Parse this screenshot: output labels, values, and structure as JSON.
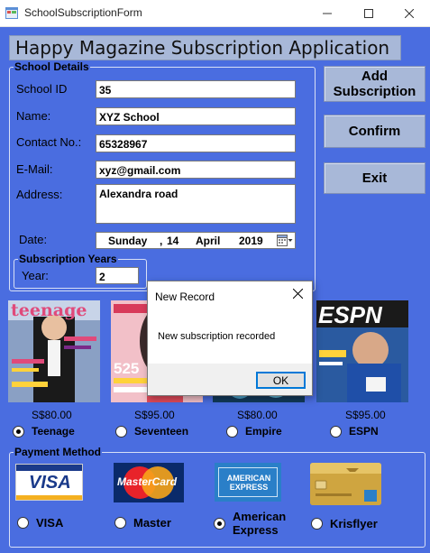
{
  "window": {
    "title": "SchoolSubscriptionForm"
  },
  "header": {
    "title": "Happy Magazine Subscription Application"
  },
  "school_details": {
    "legend": "School Details",
    "fields": {
      "school_id": {
        "label": "School ID",
        "value": "35"
      },
      "name": {
        "label": "Name:",
        "value": "XYZ School"
      },
      "contact": {
        "label": "Contact No.:",
        "value": "65328967"
      },
      "email": {
        "label": "E-Mail:",
        "value": "xyz@gmail.com"
      },
      "address": {
        "label": "Address:",
        "value": "Alexandra road"
      }
    },
    "date": {
      "label": "Date:",
      "weekday": "Sunday",
      "separator": ",",
      "day": "14",
      "month": "April",
      "year": "2019"
    },
    "subscription_years": {
      "legend": "Subscription Years",
      "label": "Year:",
      "value": "2"
    }
  },
  "buttons": {
    "add": "Add Subscription",
    "confirm": "Confirm",
    "exit": "Exit"
  },
  "magazines": [
    {
      "name": "Teenage",
      "price": "S$80.00",
      "selected": true,
      "cover_text": "teenage",
      "cover_color": "#7a8fb8"
    },
    {
      "name": "Seventeen",
      "price": "S$95.00",
      "selected": false,
      "cover_text": "525",
      "cover_color": "#d84a5a"
    },
    {
      "name": "Empire",
      "price": "S$80.00",
      "selected": false,
      "cover_text": "",
      "cover_color": "#2a7fb0"
    },
    {
      "name": "ESPN",
      "price": "S$95.00",
      "selected": false,
      "cover_text": "ESPN",
      "cover_color": "#1f5fa8"
    }
  ],
  "payment": {
    "legend": "Payment Method",
    "methods": [
      {
        "name": "VISA",
        "selected": false,
        "logo": "VISA"
      },
      {
        "name": "Master",
        "selected": false,
        "logo": "MasterCard"
      },
      {
        "name": "American Express",
        "selected": true,
        "logo": "AMERICAN EXPRESS"
      },
      {
        "name": "Krisflyer",
        "selected": false,
        "logo": ""
      }
    ]
  },
  "dialog": {
    "title": "New Record",
    "message": "New subscription recorded",
    "ok": "OK"
  },
  "colors": {
    "form_bg": "#4a6de0",
    "button_bg": "#a8b8d8",
    "dialog_accent": "#0078d7"
  }
}
